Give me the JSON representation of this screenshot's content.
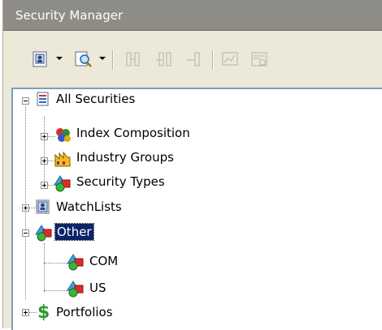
{
  "window": {
    "title": "Security Manager"
  },
  "toolbar": {
    "buttons": [
      {
        "icon": "new-watchlist-icon"
      },
      {
        "icon": "find-security-icon"
      },
      {
        "icon": "columns-icon"
      },
      {
        "icon": "add-column-icon"
      },
      {
        "icon": "remove-column-icon"
      },
      {
        "icon": "chart-window-icon"
      },
      {
        "icon": "data-window-icon"
      }
    ]
  },
  "tree": {
    "items": [
      {
        "label": "All Securities",
        "icon": "all-securities-icon",
        "expanded": true
      },
      {
        "label": "Index Composition",
        "icon": "index-composition-icon",
        "expanded": false
      },
      {
        "label": "Industry Groups",
        "icon": "industry-groups-icon",
        "expanded": false
      },
      {
        "label": "Security Types",
        "icon": "security-types-icon",
        "expanded": false
      },
      {
        "label": "WatchLists",
        "icon": "watchlist-icon",
        "expanded": false
      },
      {
        "label": "Other",
        "icon": "shapes-icon",
        "expanded": true,
        "selected": true
      },
      {
        "label": "COM",
        "icon": "shapes-icon"
      },
      {
        "label": "US",
        "icon": "shapes-icon"
      },
      {
        "label": "Portfolios",
        "icon": "dollar-icon",
        "expanded": false
      }
    ]
  },
  "colors": {
    "selection": "#0a246a",
    "titlebar": "#8e8c86",
    "toolbar": "#ece9d8"
  }
}
